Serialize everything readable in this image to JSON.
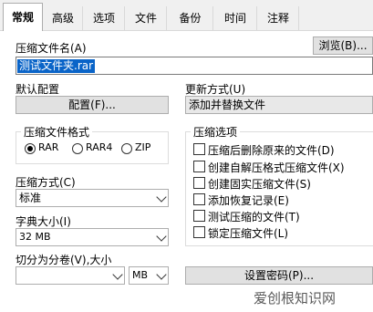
{
  "tabs": [
    "常规",
    "高级",
    "选项",
    "文件",
    "备份",
    "时间",
    "注释"
  ],
  "archive_name": {
    "label": "压缩文件名(A)",
    "value": "测试文件夹.rar",
    "browse_button": "浏览(B)..."
  },
  "default_profile": {
    "label": "默认配置",
    "button": "配置(F)..."
  },
  "update_method": {
    "label": "更新方式(U)",
    "value": "添加并替换文件"
  },
  "archive_format": {
    "label": "压缩文件格式",
    "options": [
      "RAR",
      "RAR4",
      "ZIP"
    ],
    "selected": "RAR"
  },
  "compression_method": {
    "label": "压缩方式(C)",
    "value": "标准"
  },
  "dictionary_size": {
    "label": "字典大小(I)",
    "value": "32 MB"
  },
  "split_volumes": {
    "label": "切分为分卷(V),大小",
    "value": "",
    "unit": "MB"
  },
  "options": {
    "label": "压缩选项",
    "items": [
      "压缩后删除原来的文件(D)",
      "创建自解压格式压缩文件(X)",
      "创建固实压缩文件(S)",
      "添加恢复记录(E)",
      "测试压缩的文件(T)",
      "锁定压缩文件(L)"
    ]
  },
  "password_button": "设置密码(P)...",
  "watermark": "爱创根知识网"
}
